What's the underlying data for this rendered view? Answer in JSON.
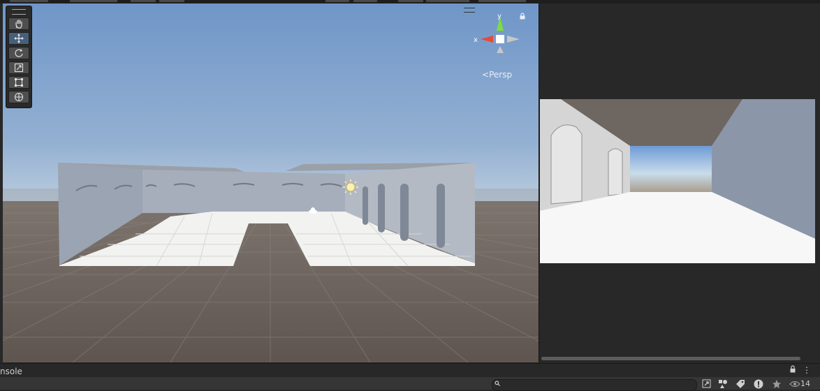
{
  "scene_view": {
    "persp_label": "Persp",
    "gizmo": {
      "x_label": "x",
      "y_label": "y",
      "x_color": "#e44b3a",
      "y_color": "#7fdc3e"
    },
    "tools": [
      {
        "name": "hand-tool",
        "icon": "hand-icon",
        "active": false
      },
      {
        "name": "move-tool",
        "icon": "move-icon",
        "active": true
      },
      {
        "name": "rotate-tool",
        "icon": "rotate-icon",
        "active": false
      },
      {
        "name": "scale-tool",
        "icon": "scale-icon",
        "active": false
      },
      {
        "name": "rect-tool",
        "icon": "rect-icon",
        "active": false
      },
      {
        "name": "transform-tool",
        "icon": "transform-icon",
        "active": false
      }
    ],
    "colors": {
      "sky_top": "#6f96c8",
      "sky_horizon": "#b9cbdd",
      "ground": "#6a5f58",
      "active_tool": "#46607c"
    }
  },
  "console": {
    "label": "nsole",
    "menu_glyph": "⋮"
  },
  "bottom_bar": {
    "search_placeholder": "",
    "visibility_count": "14",
    "icons": [
      "picker-icon",
      "shapes-icon",
      "tag-icon",
      "alert-icon",
      "star-icon",
      "eye-icon"
    ]
  }
}
